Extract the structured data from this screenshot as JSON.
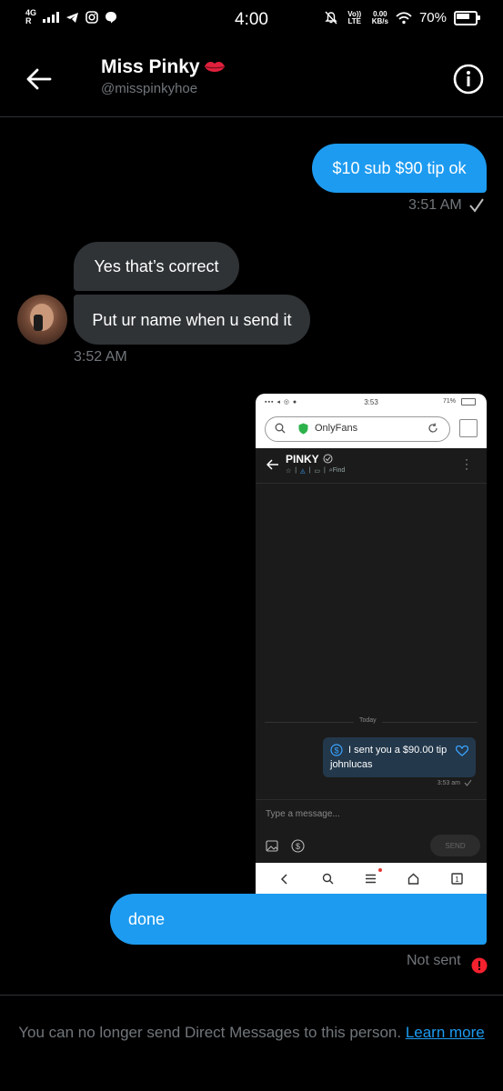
{
  "status_bar": {
    "network_type": "4G",
    "roaming": "R",
    "time": "4:00",
    "volte": "Vo)) LTE",
    "speed_value": "0.00",
    "speed_unit": "KB/s",
    "battery": "70%"
  },
  "header": {
    "name": "Miss Pinky",
    "handle": "@misspinkyhoe"
  },
  "messages": [
    {
      "text": "$10 sub $90 tip ok",
      "time": "3:51 AM"
    },
    {
      "text": "Yes that’s correct"
    },
    {
      "text": "Put ur name when u send it",
      "time": "3:52 AM"
    },
    {
      "text": "done",
      "status": "Not sent"
    }
  ],
  "embedded_screenshot": {
    "time": "3:53",
    "battery": "71%",
    "site": "OnlyFans",
    "chat_name": "PINKY",
    "find_label": "Find",
    "day_label": "Today",
    "tip_text": "I sent you a $90.00 tip",
    "tip_name": "johnlucas",
    "tip_time": "3:53 am",
    "input_placeholder": "Type a message...",
    "send_label": "SEND"
  },
  "footer": {
    "text": "You can no longer send Direct Messages to this person.",
    "link_label": "Learn more"
  },
  "colors": {
    "accent": "#1d9bf0",
    "incoming_bubble": "#2f3336",
    "error": "#f4212e"
  }
}
